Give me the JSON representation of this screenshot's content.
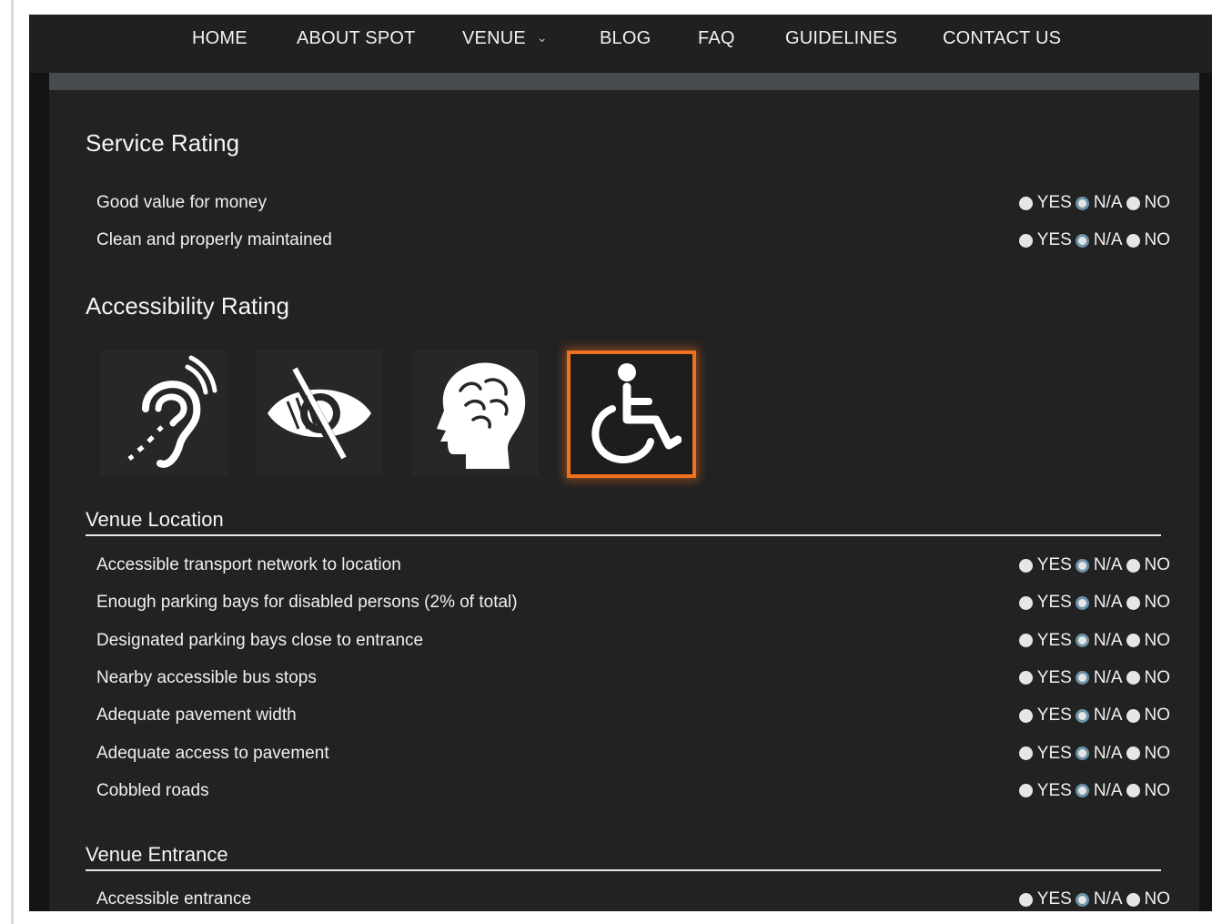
{
  "nav": {
    "items": [
      "HOME",
      "ABOUT SPOT",
      "VENUE",
      "BLOG",
      "FAQ",
      "GUIDELINES",
      "CONTACT US"
    ]
  },
  "service_rating": {
    "title": "Service Rating",
    "rows": [
      {
        "label": "Good value for money",
        "selected": "N/A"
      },
      {
        "label": "Clean and properly maintained",
        "selected": "N/A"
      }
    ]
  },
  "accessibility_rating": {
    "title": "Accessibility Rating",
    "icons": [
      "hearing-impaired-icon",
      "visually-impaired-icon",
      "cognitive-impairment-icon",
      "wheelchair-icon"
    ],
    "selected_icon": "wheelchair-icon",
    "accent_color": "#f07020"
  },
  "venue_location": {
    "title": "Venue Location",
    "rows": [
      {
        "label": "Accessible transport network to location",
        "selected": "N/A"
      },
      {
        "label": "Enough parking bays for disabled persons (2% of total)",
        "selected": "N/A"
      },
      {
        "label": "Designated parking bays close to entrance",
        "selected": "N/A"
      },
      {
        "label": "Nearby accessible bus stops",
        "selected": "N/A"
      },
      {
        "label": "Adequate pavement width",
        "selected": "N/A"
      },
      {
        "label": "Adequate access to pavement",
        "selected": "N/A"
      },
      {
        "label": "Cobbled roads",
        "selected": "N/A"
      }
    ]
  },
  "venue_entrance": {
    "title": "Venue Entrance",
    "rows": [
      {
        "label": "Accessible entrance",
        "selected": "N/A"
      }
    ]
  },
  "options": {
    "yes": "YES",
    "na": "N/A",
    "no": "NO"
  }
}
